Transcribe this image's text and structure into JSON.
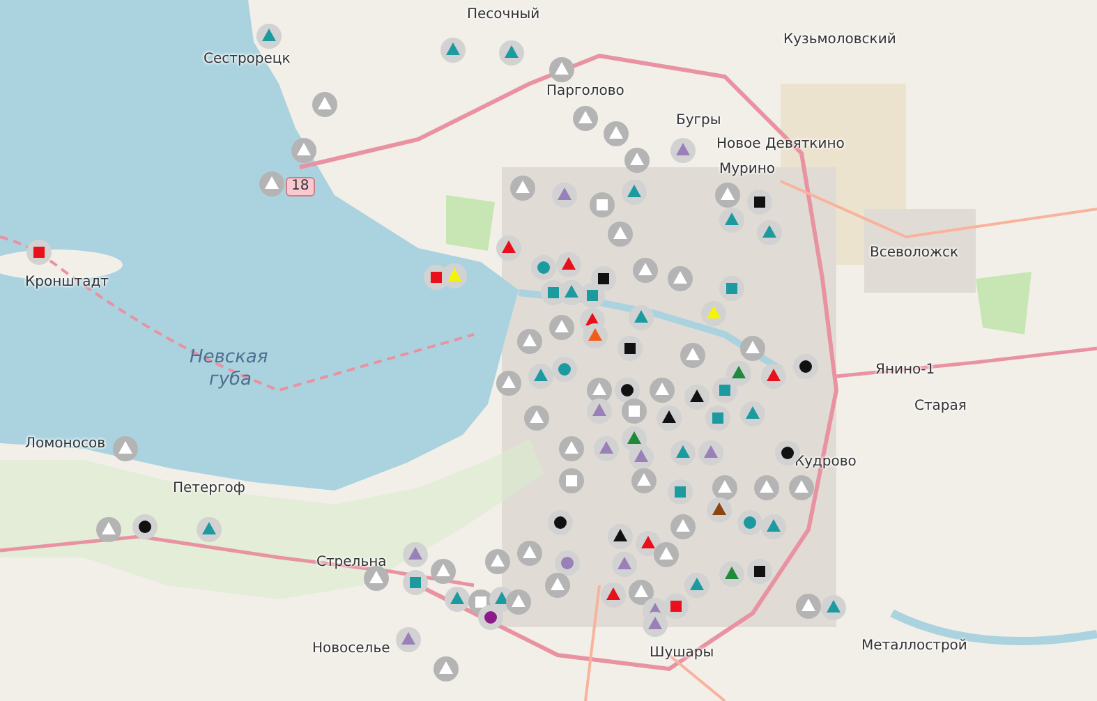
{
  "map": {
    "labels": [
      {
        "text": "Песочный",
        "kind": "place"
      },
      {
        "text": "Сестрорецк",
        "kind": "place"
      },
      {
        "text": "Кузьмоловский",
        "kind": "place"
      },
      {
        "text": "Парголово",
        "kind": "place"
      },
      {
        "text": "Бугры",
        "kind": "place"
      },
      {
        "text": "Новое Девяткино",
        "kind": "place"
      },
      {
        "text": "Мурино",
        "kind": "place"
      },
      {
        "text": "Всеволожск",
        "kind": "place"
      },
      {
        "text": "Кронштадт",
        "kind": "place"
      },
      {
        "text": "Невская",
        "kind": "water"
      },
      {
        "text": "губа",
        "kind": "water"
      },
      {
        "text": "Янино-1",
        "kind": "place"
      },
      {
        "text": "Старая",
        "kind": "place"
      },
      {
        "text": "Ломоносов",
        "kind": "place"
      },
      {
        "text": "Кудрово",
        "kind": "place"
      },
      {
        "text": "Петергоф",
        "kind": "place"
      },
      {
        "text": "Стрельна",
        "kind": "place"
      },
      {
        "text": "Новоселье",
        "kind": "place"
      },
      {
        "text": "Шушары",
        "kind": "place"
      },
      {
        "text": "Металлострой",
        "kind": "place"
      },
      {
        "text": "18",
        "kind": "shield"
      }
    ]
  },
  "markers": [
    {
      "kind": "triangle",
      "color": "#1b9aa0"
    },
    {
      "kind": "triangle",
      "color": "#1b9aa0"
    },
    {
      "kind": "triangle",
      "color": "#1b9aa0"
    },
    {
      "kind": "triangle",
      "color": "#ffffff"
    },
    {
      "kind": "triangle",
      "color": "#ffffff"
    },
    {
      "kind": "triangle",
      "color": "#ffffff"
    },
    {
      "kind": "triangle",
      "color": "#ffffff"
    },
    {
      "kind": "triangle",
      "color": "#ffffff"
    },
    {
      "kind": "triangle",
      "color": "#ffffff"
    },
    {
      "kind": "triangle",
      "color": "#9a80b8"
    },
    {
      "kind": "triangle",
      "color": "#ffffff"
    },
    {
      "kind": "triangle",
      "color": "#ffffff"
    },
    {
      "kind": "triangle",
      "color": "#9a80b8"
    },
    {
      "kind": "triangle",
      "color": "#ffffff"
    },
    {
      "kind": "triangle",
      "color": "#1b9aa0"
    },
    {
      "kind": "square",
      "color": "#ffffff"
    },
    {
      "kind": "square",
      "color": "#111111"
    },
    {
      "kind": "triangle",
      "color": "#1b9aa0"
    },
    {
      "kind": "triangle",
      "color": "#1b9aa0"
    },
    {
      "kind": "triangle",
      "color": "#ffffff"
    },
    {
      "kind": "triangle",
      "color": "#e8101a"
    },
    {
      "kind": "dot",
      "color": "#1b9aa0"
    },
    {
      "kind": "triangle",
      "color": "#e8101a"
    },
    {
      "kind": "triangle",
      "color": "#f5f500"
    },
    {
      "kind": "square",
      "color": "#e8101a"
    },
    {
      "kind": "square",
      "color": "#e8101a"
    },
    {
      "kind": "triangle",
      "color": "#ffffff"
    },
    {
      "kind": "square",
      "color": "#111111"
    },
    {
      "kind": "square",
      "color": "#1b9aa0"
    },
    {
      "kind": "triangle",
      "color": "#1b9aa0"
    },
    {
      "kind": "square",
      "color": "#1b9aa0"
    },
    {
      "kind": "triangle",
      "color": "#ffffff"
    },
    {
      "kind": "square",
      "color": "#1b9aa0"
    },
    {
      "kind": "triangle",
      "color": "#f5f500"
    },
    {
      "kind": "triangle",
      "color": "#1b9aa0"
    },
    {
      "kind": "triangle",
      "color": "#e8101a"
    },
    {
      "kind": "triangle",
      "color": "#f25c1b"
    },
    {
      "kind": "triangle",
      "color": "#ffffff"
    },
    {
      "kind": "triangle",
      "color": "#ffffff"
    },
    {
      "kind": "square",
      "color": "#111111"
    },
    {
      "kind": "triangle",
      "color": "#ffffff"
    },
    {
      "kind": "triangle",
      "color": "#ffffff"
    },
    {
      "kind": "dot",
      "color": "#111111"
    },
    {
      "kind": "triangle",
      "color": "#e8101a"
    },
    {
      "kind": "triangle",
      "color": "#1e8a3a"
    },
    {
      "kind": "triangle",
      "color": "#1b9aa0"
    },
    {
      "kind": "dot",
      "color": "#1b9aa0"
    },
    {
      "kind": "triangle",
      "color": "#ffffff"
    },
    {
      "kind": "triangle",
      "color": "#ffffff"
    },
    {
      "kind": "dot",
      "color": "#111111"
    },
    {
      "kind": "triangle",
      "color": "#ffffff"
    },
    {
      "kind": "triangle",
      "color": "#111111"
    },
    {
      "kind": "square",
      "color": "#1b9aa0"
    },
    {
      "kind": "triangle",
      "color": "#1b9aa0"
    },
    {
      "kind": "triangle",
      "color": "#9a80b8"
    },
    {
      "kind": "square",
      "color": "#ffffff"
    },
    {
      "kind": "triangle",
      "color": "#111111"
    },
    {
      "kind": "square",
      "color": "#1b9aa0"
    },
    {
      "kind": "triangle",
      "color": "#ffffff"
    },
    {
      "kind": "triangle",
      "color": "#ffffff"
    },
    {
      "kind": "triangle",
      "color": "#9a80b8"
    },
    {
      "kind": "triangle",
      "color": "#1e8a3a"
    },
    {
      "kind": "triangle",
      "color": "#9a80b8"
    },
    {
      "kind": "triangle",
      "color": "#1b9aa0"
    },
    {
      "kind": "triangle",
      "color": "#9a80b8"
    },
    {
      "kind": "dot",
      "color": "#111111"
    },
    {
      "kind": "triangle",
      "color": "#ffffff"
    },
    {
      "kind": "triangle",
      "color": "#ffffff"
    },
    {
      "kind": "square",
      "color": "#ffffff"
    },
    {
      "kind": "triangle",
      "color": "#ffffff"
    },
    {
      "kind": "square",
      "color": "#1b9aa0"
    },
    {
      "kind": "triangle",
      "color": "#ffffff"
    },
    {
      "kind": "triangle",
      "color": "#ffffff"
    },
    {
      "kind": "triangle",
      "color": "#ffffff"
    },
    {
      "kind": "dot",
      "color": "#111111"
    },
    {
      "kind": "triangle",
      "color": "#1b9aa0"
    },
    {
      "kind": "dot",
      "color": "#111111"
    },
    {
      "kind": "triangle",
      "color": "#111111"
    },
    {
      "kind": "triangle",
      "color": "#e8101a"
    },
    {
      "kind": "triangle",
      "color": "#ffffff"
    },
    {
      "kind": "triangle",
      "color": "#8b4513"
    },
    {
      "kind": "dot",
      "color": "#1b9aa0"
    },
    {
      "kind": "triangle",
      "color": "#1b9aa0"
    },
    {
      "kind": "triangle",
      "color": "#ffffff"
    },
    {
      "kind": "triangle",
      "color": "#ffffff"
    },
    {
      "kind": "dot",
      "color": "#9a80b8"
    },
    {
      "kind": "triangle",
      "color": "#9a80b8"
    },
    {
      "kind": "triangle",
      "color": "#ffffff"
    },
    {
      "kind": "triangle",
      "color": "#9a80b8"
    },
    {
      "kind": "square",
      "color": "#1b9aa0"
    },
    {
      "kind": "triangle",
      "color": "#ffffff"
    },
    {
      "kind": "triangle",
      "color": "#ffffff"
    },
    {
      "kind": "triangle",
      "color": "#ffffff"
    },
    {
      "kind": "triangle",
      "color": "#ffffff"
    },
    {
      "kind": "triangle",
      "color": "#1b9aa0"
    },
    {
      "kind": "triangle",
      "color": "#1e8a3a"
    },
    {
      "kind": "square",
      "color": "#111111"
    },
    {
      "kind": "triangle",
      "color": "#1b9aa0"
    },
    {
      "kind": "square",
      "color": "#ffffff"
    },
    {
      "kind": "triangle",
      "color": "#1b9aa0"
    },
    {
      "kind": "triangle",
      "color": "#ffffff"
    },
    {
      "kind": "triangle",
      "color": "#e8101a"
    },
    {
      "kind": "triangle",
      "color": "#9a80b8"
    },
    {
      "kind": "square",
      "color": "#e8101a"
    },
    {
      "kind": "dot",
      "color": "#8b1a8b"
    },
    {
      "kind": "triangle",
      "color": "#ffffff"
    },
    {
      "kind": "triangle",
      "color": "#1b9aa0"
    },
    {
      "kind": "triangle",
      "color": "#9a80b8"
    },
    {
      "kind": "triangle",
      "color": "#9a80b8"
    },
    {
      "kind": "triangle",
      "color": "#ffffff"
    }
  ]
}
